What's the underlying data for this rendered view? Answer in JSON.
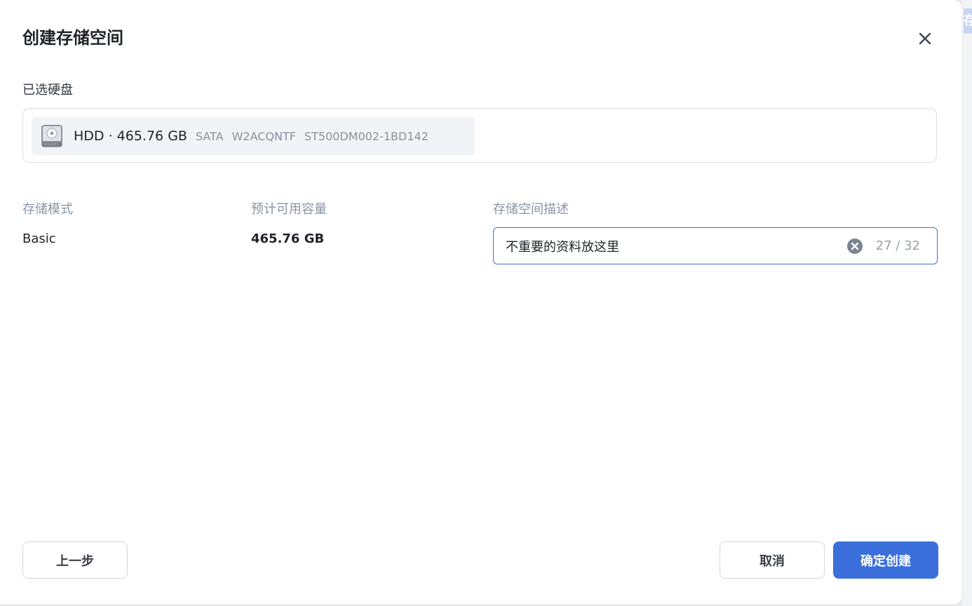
{
  "dialog": {
    "title": "创建存储空间",
    "close_icon": "close-icon"
  },
  "background": {
    "peek_text": "存"
  },
  "selected_disks": {
    "label": "已选硬盘",
    "disk": {
      "icon": "hard-disk-icon",
      "type_size": "HDD · 465.76 GB",
      "interface": "SATA",
      "serial": "W2ACQNTF",
      "model": "ST500DM002-1BD142"
    }
  },
  "fields": {
    "mode": {
      "label": "存储模式",
      "value": "Basic"
    },
    "capacity": {
      "label": "预计可用容量",
      "value": "465.76 GB"
    },
    "description": {
      "label": "存储空间描述",
      "value": "不重要的资料放这里",
      "counter": "27 / 32",
      "clear_icon": "clear-circle-icon"
    }
  },
  "footer": {
    "back_label": "上一步",
    "cancel_label": "取消",
    "confirm_label": "确定创建"
  },
  "colors": {
    "primary": "#3b6fdc",
    "input_focus_border": "#3f72d4",
    "muted_text": "#8a94a3"
  }
}
